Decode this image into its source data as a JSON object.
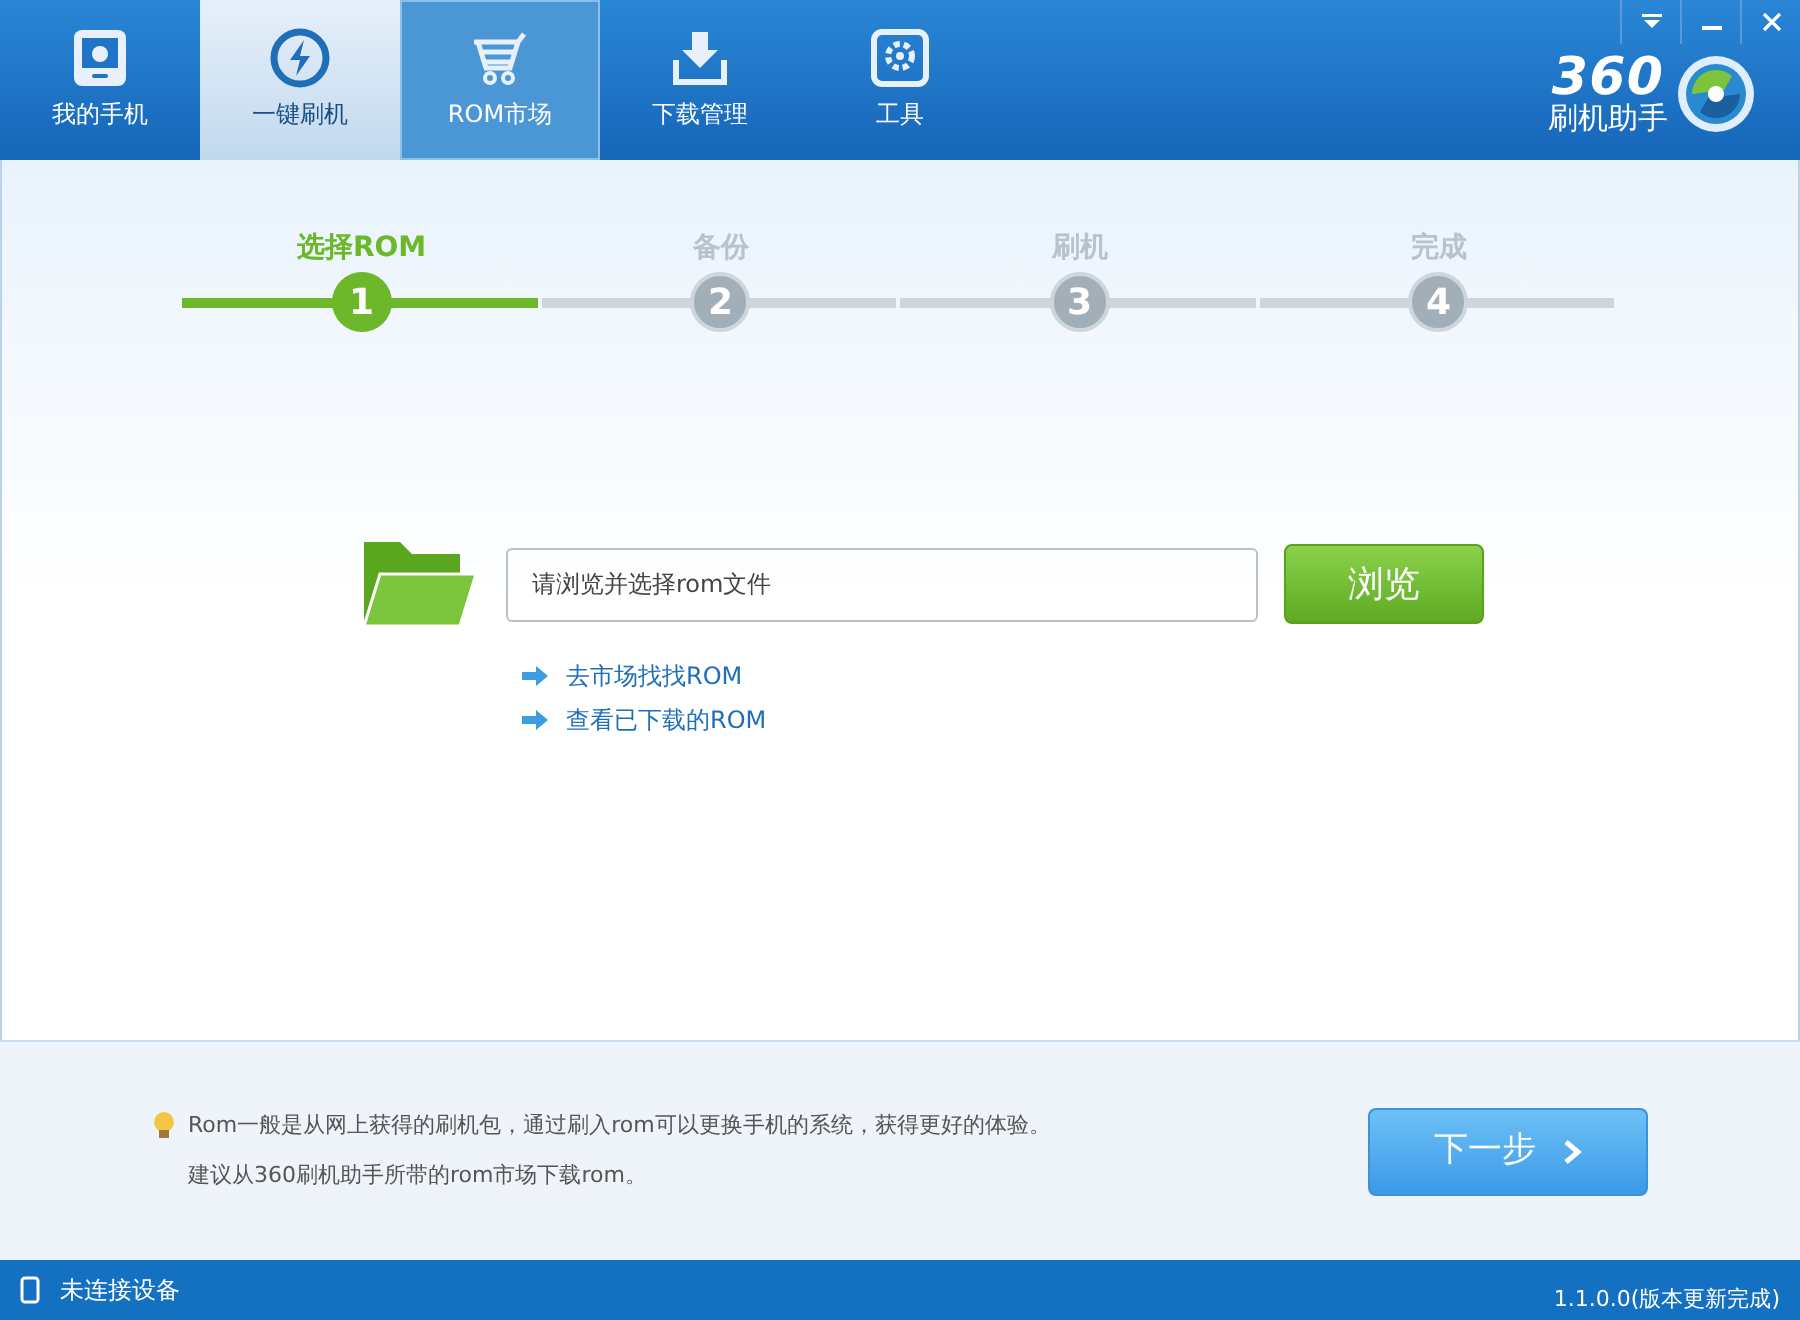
{
  "tabs": [
    {
      "label": "我的手机",
      "kind": "phone",
      "selected": false,
      "hovered": false
    },
    {
      "label": "一键刷机",
      "kind": "flash",
      "selected": true,
      "hovered": false
    },
    {
      "label": "ROM市场",
      "kind": "cart",
      "selected": false,
      "hovered": true
    },
    {
      "label": "下载管理",
      "kind": "download",
      "selected": false,
      "hovered": false
    },
    {
      "label": "工具",
      "kind": "tools",
      "selected": false,
      "hovered": false
    }
  ],
  "logo": {
    "number": "360",
    "name": "刷机助手"
  },
  "steps": [
    {
      "label": "选择ROM",
      "number": "1",
      "selected": true
    },
    {
      "label": "备份",
      "number": "2",
      "selected": false
    },
    {
      "label": "刷机",
      "number": "3",
      "selected": false
    },
    {
      "label": "完成",
      "number": "4",
      "selected": false
    }
  ],
  "file_field": {
    "placeholder": "请浏览并选择rom文件"
  },
  "browse_button": "浏览",
  "links": [
    "去市场找找ROM",
    "查看已下载的ROM"
  ],
  "tips": [
    "Rom一般是从网上获得的刷机包，通过刷入rom可以更换手机的系统，获得更好的体验。",
    "建议从360刷机助手所带的rom市场下载rom。"
  ],
  "next_button": "下一步",
  "status_bar": {
    "device": "未连接设备",
    "version": "1.1.0.0(版本更新完成)"
  }
}
